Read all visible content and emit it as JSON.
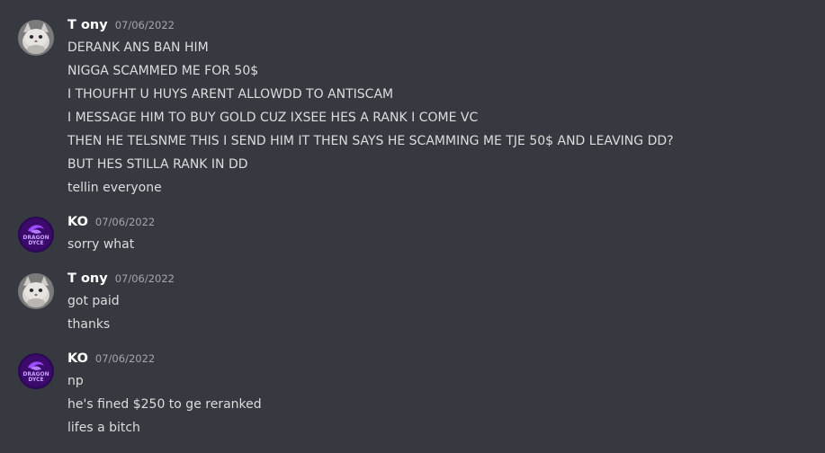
{
  "messages": [
    {
      "username": "T ony",
      "timestamp": "07/06/2022",
      "avatar_icon": "cat-avatar-icon",
      "lines": [
        "DERANK ANS BAN HIM",
        "NIGGA SCAMMED ME FOR 50$",
        "I THOUFHT U HUYS ARENT ALLOWDD TO ANTISCAM",
        "I MESSAGE HIM TO BUY GOLD CUZ IXSEE HES A RANK I COME VC",
        "THEN HE TELSNME THIS I SEND HIM IT THEN SAYS HE SCAMMING ME TJE 50$ AND LEAVING DD?",
        "BUT HES STILLA RANK IN DD",
        "tellin everyone"
      ]
    },
    {
      "username": "KO",
      "timestamp": "07/06/2022",
      "avatar_icon": "dragon-dyce-logo-icon",
      "avatar_text": "DRAGON DYCE",
      "lines": [
        "sorry what"
      ]
    },
    {
      "username": "T ony",
      "timestamp": "07/06/2022",
      "avatar_icon": "cat-avatar-icon",
      "lines": [
        "got paid",
        "thanks"
      ]
    },
    {
      "username": "KO",
      "timestamp": "07/06/2022",
      "avatar_icon": "dragon-dyce-logo-icon",
      "avatar_text": "DRAGON DYCE",
      "lines": [
        "np",
        "he's fined $250 to ge reranked",
        "lifes a bitch"
      ]
    }
  ],
  "colors": {
    "background": "#36393f",
    "username": "#ffffff",
    "timestamp": "#a3a6aa",
    "message_text": "#dcddde",
    "ko_avatar": "#3b0a6b"
  }
}
